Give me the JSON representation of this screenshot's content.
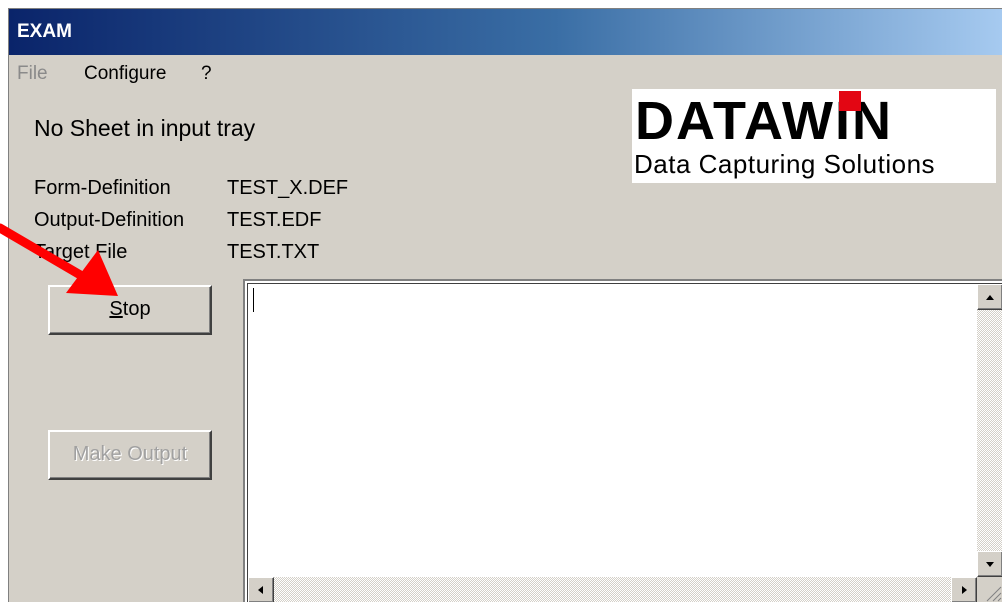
{
  "window": {
    "title": "EXAM"
  },
  "menu": {
    "file": "File",
    "configure": "Configure",
    "help": "?"
  },
  "status": "No Sheet in input tray",
  "logo": {
    "brand": "DATAWIN",
    "tagline": "Data Capturing Solutions"
  },
  "info": [
    {
      "label": "Form-Definition",
      "value": "TEST_X.DEF"
    },
    {
      "label": "Output-Definition",
      "value": "TEST.EDF"
    },
    {
      "label": "Target File",
      "value": "TEST.TXT"
    }
  ],
  "buttons": {
    "stop_mnemonic": "S",
    "stop_rest": "top",
    "make_output": "Make Output"
  },
  "output_text": "",
  "colors": {
    "title_start": "#0a246a",
    "title_end": "#a6caf0",
    "face": "#d4d0c8",
    "arrow": "#ff0000",
    "logo_accent": "#e30613"
  }
}
